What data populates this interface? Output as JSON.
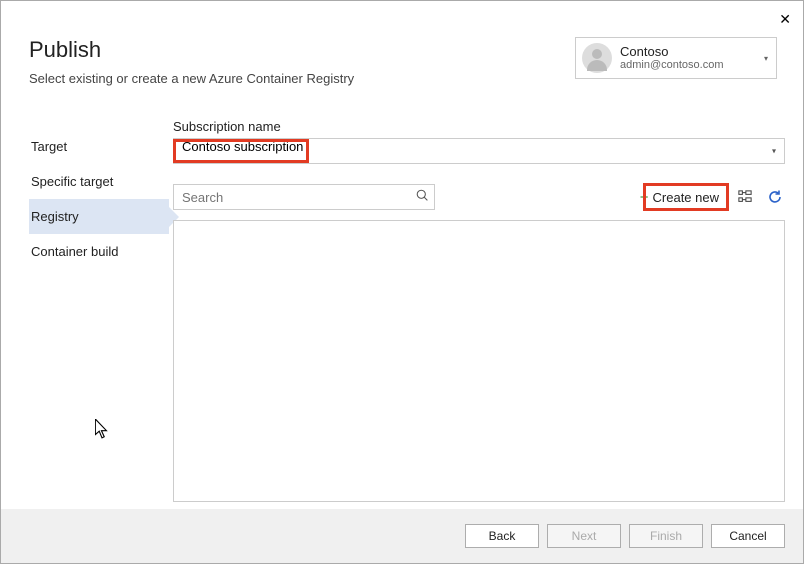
{
  "header": {
    "title": "Publish",
    "subtitle": "Select existing or create a new Azure Container Registry"
  },
  "account": {
    "name": "Contoso",
    "email": "admin@contoso.com"
  },
  "nav": {
    "items": [
      {
        "label": "Target"
      },
      {
        "label": "Specific target"
      },
      {
        "label": "Registry"
      },
      {
        "label": "Container build"
      }
    ],
    "activeIndex": 2
  },
  "subscription": {
    "label": "Subscription name",
    "value": "Contoso subscription"
  },
  "search": {
    "placeholder": "Search"
  },
  "toolbar": {
    "createNew": "Create new"
  },
  "footer": {
    "back": "Back",
    "next": "Next",
    "finish": "Finish",
    "cancel": "Cancel"
  }
}
